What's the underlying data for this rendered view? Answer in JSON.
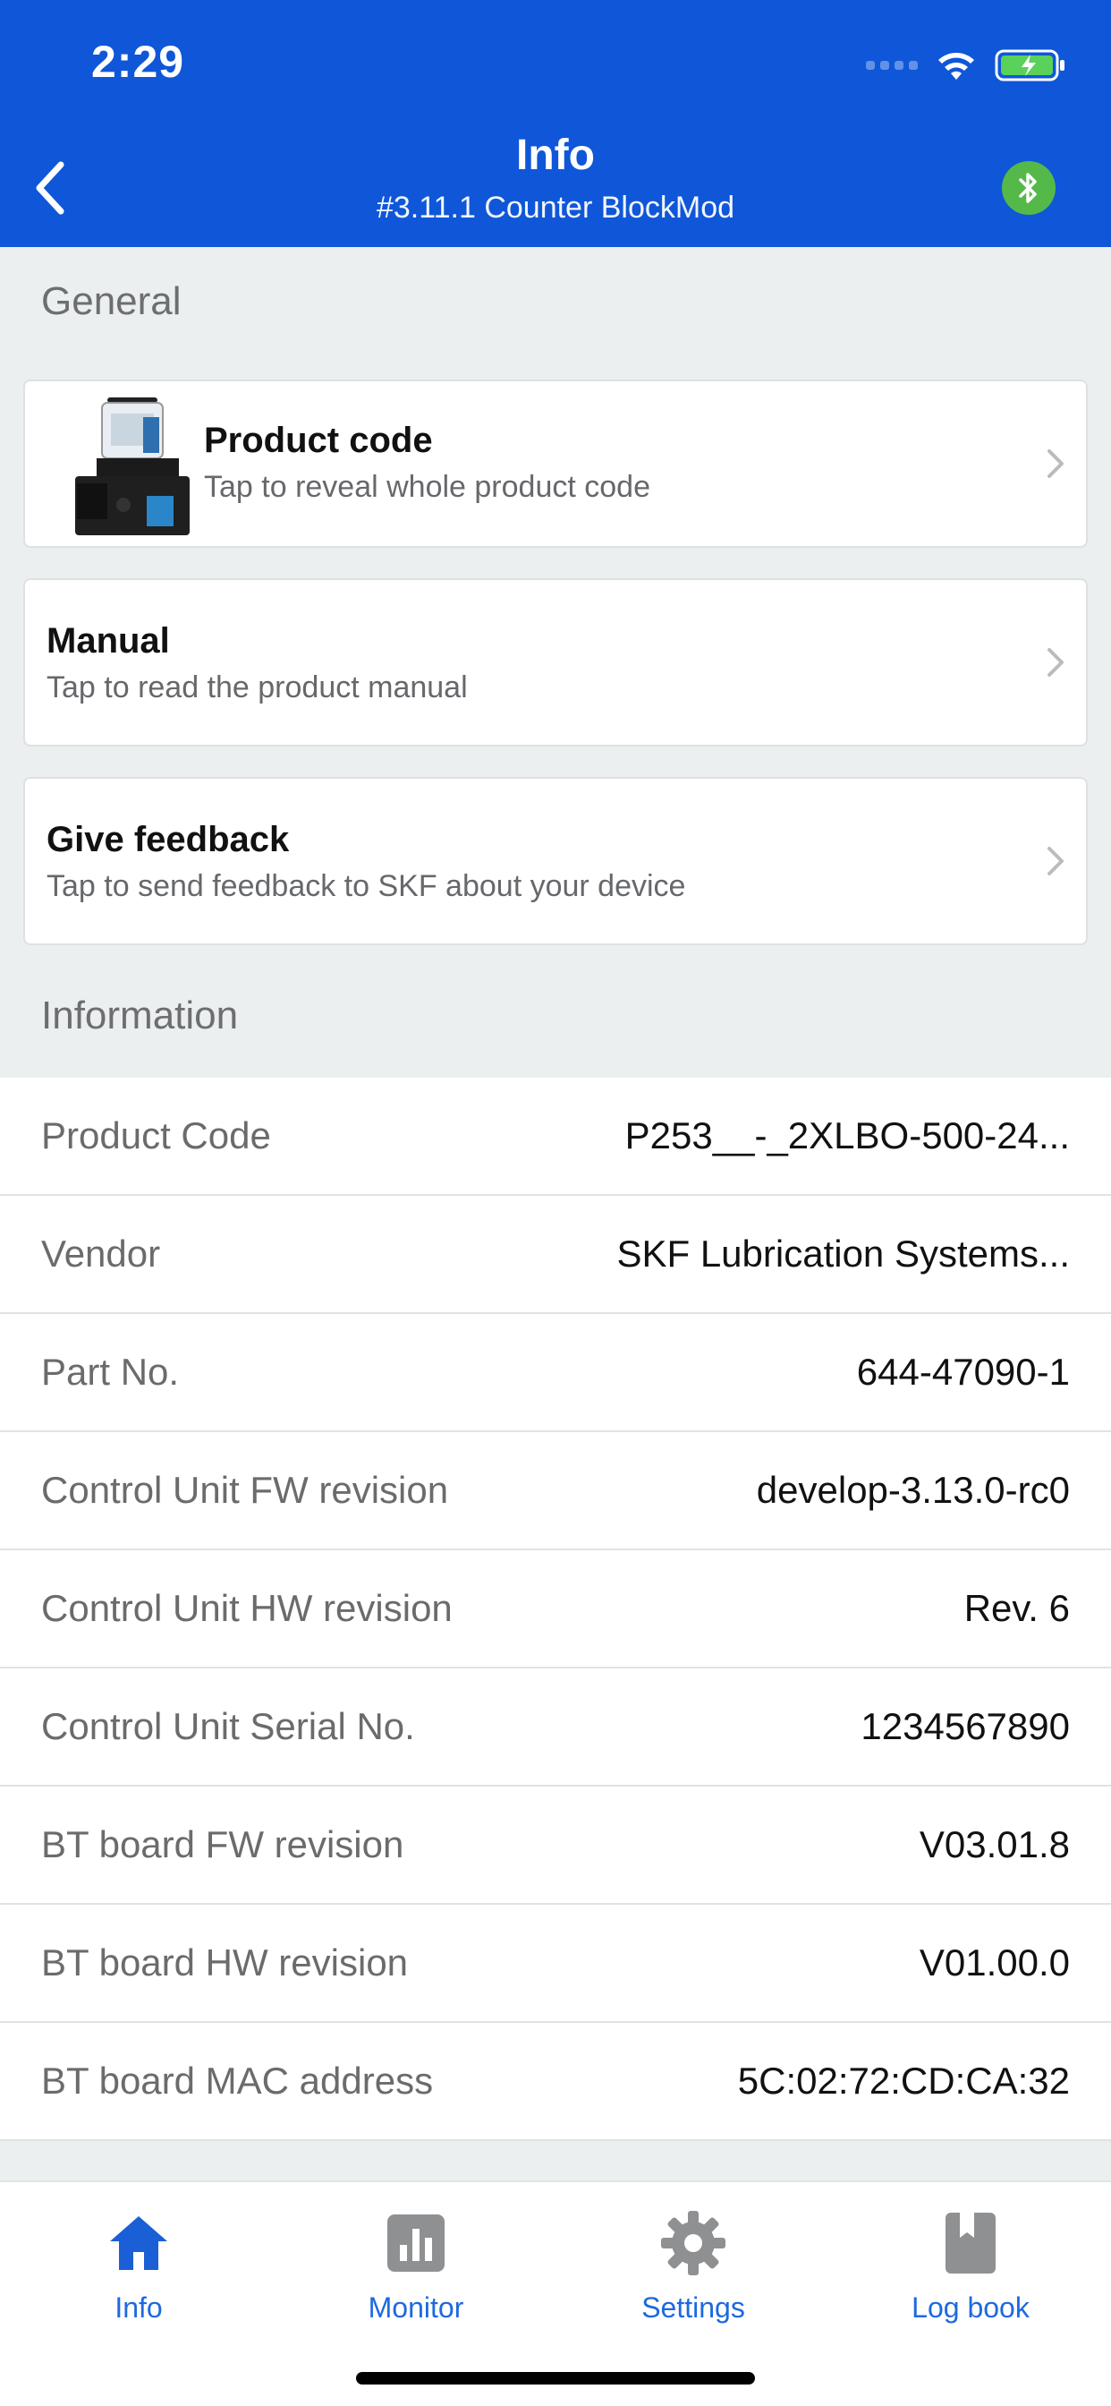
{
  "status_bar": {
    "time": "2:29"
  },
  "header": {
    "title": "Info",
    "subtitle": "#3.11.1 Counter BlockMod"
  },
  "sections": {
    "general": "General",
    "information": "Information"
  },
  "cards": [
    {
      "title": "Product code",
      "subtitle": "Tap to reveal whole product code"
    },
    {
      "title": "Manual",
      "subtitle": "Tap to read the product manual"
    },
    {
      "title": "Give feedback",
      "subtitle": "Tap to send feedback to SKF about your device"
    }
  ],
  "info": [
    {
      "label": "Product Code",
      "value": "P253__-_2XLBO-500-24..."
    },
    {
      "label": "Vendor",
      "value": "SKF Lubrication Systems..."
    },
    {
      "label": "Part No.",
      "value": "644-47090-1"
    },
    {
      "label": "Control Unit FW revision",
      "value": "develop-3.13.0-rc0"
    },
    {
      "label": "Control Unit HW revision",
      "value": "Rev. 6"
    },
    {
      "label": "Control Unit Serial No.",
      "value": "1234567890"
    },
    {
      "label": "BT board FW revision",
      "value": "V03.01.8"
    },
    {
      "label": "BT board HW revision",
      "value": "V01.00.0"
    },
    {
      "label": "BT board MAC address",
      "value": "5C:02:72:CD:CA:32"
    }
  ],
  "tabs": [
    {
      "label": "Info",
      "icon": "home-icon",
      "active": true
    },
    {
      "label": "Monitor",
      "icon": "bar-chart-icon",
      "active": false
    },
    {
      "label": "Settings",
      "icon": "gear-icon",
      "active": false
    },
    {
      "label": "Log book",
      "icon": "book-icon",
      "active": false
    }
  ],
  "colors": {
    "header": "#0f57d8",
    "accent": "#1d69e0",
    "bluetooth": "#55b94a",
    "background": "#ebefef"
  }
}
